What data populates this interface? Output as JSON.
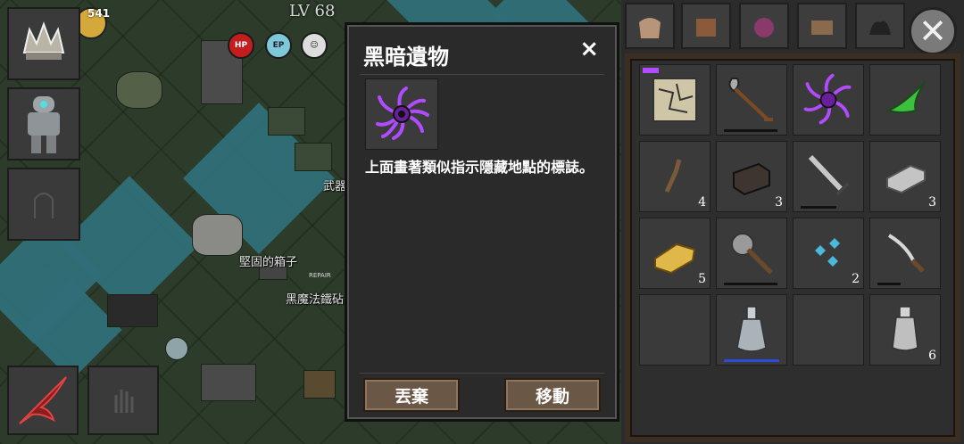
{
  "hud": {
    "level": "LV 68",
    "stat_hp": "HP",
    "stat_ep": "EP",
    "time_badge": "541"
  },
  "map_labels": {
    "weapon": "武器",
    "sturdy_box": "堅固的箱子",
    "black_magic": "黑魔法鐵砧",
    "repair_tag": "REPAIR"
  },
  "dialog": {
    "title": "黑暗遺物",
    "close": "×",
    "description": "上面畫著類似指示隱藏地點的標誌。",
    "discard": "丟棄",
    "move": "移動"
  },
  "panel": {
    "close": "✕"
  },
  "inventory": {
    "slots": [
      {
        "name": "map-scroll",
        "count": ""
      },
      {
        "name": "shovel",
        "count": ""
      },
      {
        "name": "dark-relic",
        "count": ""
      },
      {
        "name": "green-herb",
        "count": ""
      },
      {
        "name": "wood-branch",
        "count": "4"
      },
      {
        "name": "brick",
        "count": "3"
      },
      {
        "name": "iron-sword",
        "count": ""
      },
      {
        "name": "iron-ingot",
        "count": "3"
      },
      {
        "name": "gold-ingot",
        "count": "5"
      },
      {
        "name": "spiked-mace",
        "count": ""
      },
      {
        "name": "blue-crystal",
        "count": "2"
      },
      {
        "name": "dagger",
        "count": ""
      },
      {
        "name": "empty",
        "count": ""
      },
      {
        "name": "glass-bottle",
        "count": ""
      },
      {
        "name": "empty",
        "count": ""
      },
      {
        "name": "clear-bottle",
        "count": "6"
      }
    ]
  },
  "colors": {
    "dialog_bg": "#2a2a2a",
    "button": "#6b5746",
    "accent_purple": "#b14bff"
  }
}
